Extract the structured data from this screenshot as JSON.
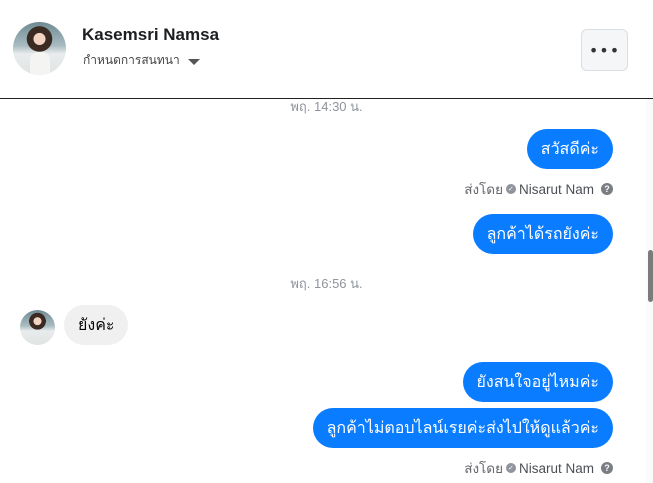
{
  "header": {
    "contact_name": "Kasemsri Namsa",
    "subtitle": "กำหนดการสนทนา",
    "more_label": "•••"
  },
  "timestamps": [
    "พฤ. 14:30 น.",
    "พฤ. 16:56 น."
  ],
  "messages": [
    {
      "text": "สวัสดีค่ะ",
      "direction": "outgoing"
    },
    {
      "text": "ลูกค้าได้รถยังค่ะ",
      "direction": "outgoing"
    },
    {
      "text": "ยังค่ะ",
      "direction": "incoming"
    },
    {
      "text": "ยังสนใจอยู่ไหมค่ะ",
      "direction": "outgoing"
    },
    {
      "text": "ลูกค้าไม่ตอบไลน์เรยค่ะส่งไปให้ดูแล้วค่ะ",
      "direction": "outgoing"
    }
  ],
  "sent_by": {
    "prefix": "ส่งโดย",
    "name": "Nisarut Nam",
    "help": "?"
  },
  "colors": {
    "outgoing_bubble": "#0a7cff",
    "incoming_bubble": "#f0f0f0"
  }
}
